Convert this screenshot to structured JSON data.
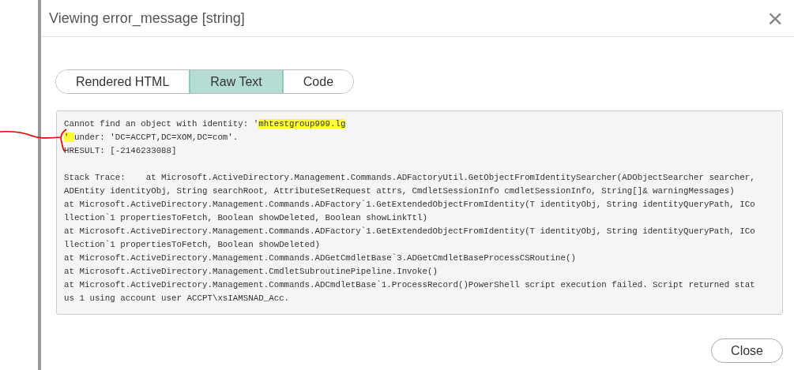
{
  "dialog": {
    "title": "Viewing error_message [string]",
    "close_icon": "×"
  },
  "tabs": [
    {
      "label": "Rendered HTML",
      "selected": false
    },
    {
      "label": "Raw Text",
      "selected": true
    },
    {
      "label": "Code",
      "selected": false
    }
  ],
  "raw_text": [
    [
      {
        "text": "Cannot find an object with identity: '",
        "highlighted": false
      },
      {
        "text": "mhtestgroup999.lg",
        "highlighted": true
      }
    ],
    [
      {
        "text": "' ",
        "highlighted": true
      },
      {
        "text": "under: 'DC=ACCPT,DC=XOM,DC=com'.",
        "highlighted": false
      }
    ],
    [
      {
        "text": "HRESULT: [-2146233088]\n",
        "highlighted": false
      }
    ],
    [
      {
        "text": "Stack Trace:    at Microsoft.ActiveDirectory.Management.Commands.ADFactoryUtil.GetObjectFromIdentitySearcher(ADObjectSearcher searcher,",
        "highlighted": false
      }
    ],
    [
      {
        "text": "ADEntity identityObj, String searchRoot, AttributeSetRequest attrs, CmdletSessionInfo cmdletSessionInfo, String[]& warningMessages)",
        "highlighted": false
      }
    ],
    [
      {
        "text": "at Microsoft.ActiveDirectory.Management.Commands.ADFactory`1.GetExtendedObjectFromIdentity(T identityObj, String identityQueryPath, ICo",
        "highlighted": false
      }
    ],
    [
      {
        "text": "llection`1 propertiesToFetch, Boolean showDeleted, Boolean showLinkTtl)",
        "highlighted": false
      }
    ],
    [
      {
        "text": "at Microsoft.ActiveDirectory.Management.Commands.ADFactory`1.GetExtendedObjectFromIdentity(T identityObj, String identityQueryPath, ICo",
        "highlighted": false
      }
    ],
    [
      {
        "text": "llection`1 propertiesToFetch, Boolean showDeleted)",
        "highlighted": false
      }
    ],
    [
      {
        "text": "at Microsoft.ActiveDirectory.Management.Commands.ADGetCmdletBase`3.ADGetCmdletBaseProcessCSRoutine()",
        "highlighted": false
      }
    ],
    [
      {
        "text": "at Microsoft.ActiveDirectory.Management.CmdletSubroutinePipeline.Invoke()",
        "highlighted": false
      }
    ],
    [
      {
        "text": "at Microsoft.ActiveDirectory.Management.Commands.ADCmdletBase`1.ProcessRecord()PowerShell script execution failed. Script returned stat",
        "highlighted": false
      }
    ],
    [
      {
        "text": "us 1 using account user ACCPT\\xsIAMSNAD_Acc.",
        "highlighted": false
      }
    ]
  ],
  "buttons": [
    {
      "label": "Close"
    }
  ]
}
